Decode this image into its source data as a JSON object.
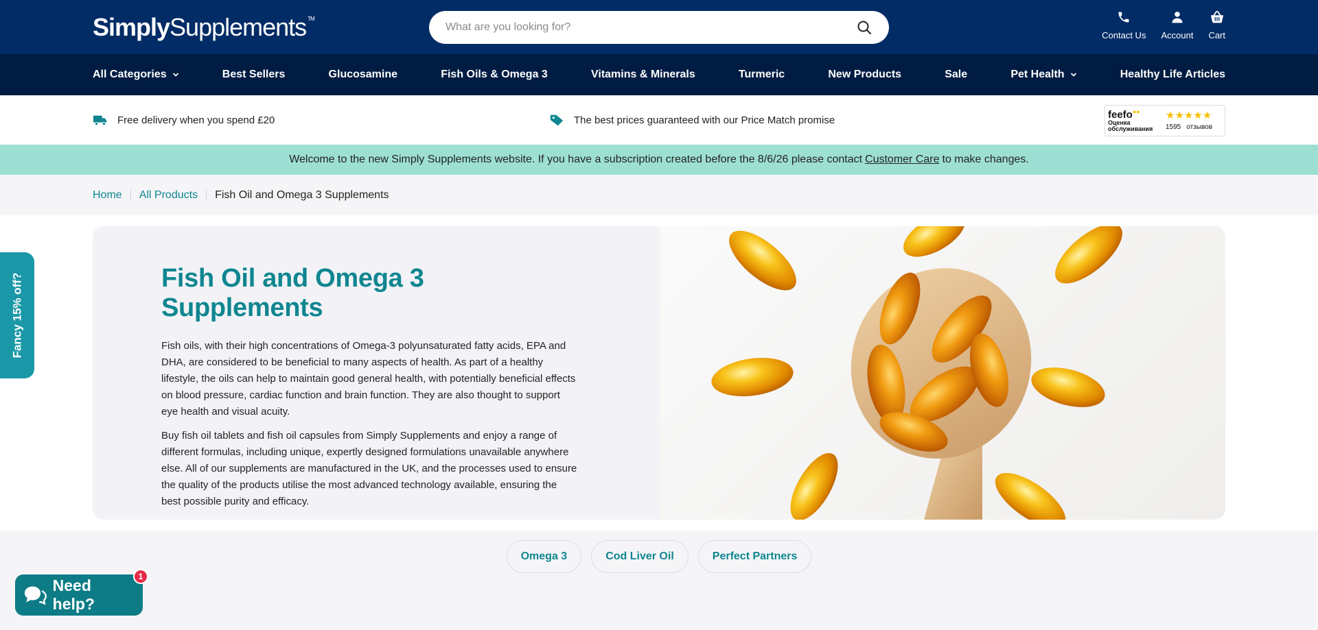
{
  "header": {
    "logo_bold": "Simply",
    "logo_rest": "Supplements",
    "logo_tm": "TM",
    "search_placeholder": "What are you looking for?",
    "links": {
      "contact": "Contact Us",
      "account": "Account",
      "cart": "Cart"
    }
  },
  "nav": {
    "items": [
      "All Categories",
      "Best Sellers",
      "Glucosamine",
      "Fish Oils & Omega 3",
      "Vitamins & Minerals",
      "Turmeric",
      "New Products",
      "Sale",
      "Pet Health",
      "Healthy Life Articles"
    ]
  },
  "usp": {
    "delivery": "Free delivery when you spend £20",
    "price": "The best prices guaranteed with our Price Match promise",
    "feefo": {
      "brand": "feefo",
      "sub": "Оценка обслуживания",
      "stars": "★★★★★",
      "count": "1595",
      "reviews": "отзывов"
    }
  },
  "notice": {
    "before": "Welcome to the new Simply Supplements website. If you have a subscription created before the 8/6/26 please contact",
    "link": "Customer Care",
    "after": "to make changes."
  },
  "breadcrumb": {
    "home": "Home",
    "all": "All Products",
    "current": "Fish Oil and Omega 3 Supplements"
  },
  "hero": {
    "title": "Fish Oil and Omega 3 Supplements",
    "p1": "Fish oils, with their high concentrations of Omega-3 polyunsaturated fatty acids, EPA and DHA, are considered to be beneficial to many aspects of health. As part of a healthy lifestyle, the oils can help to maintain good general health, with potentially beneficial effects on blood pressure, cardiac function and brain function. They are also thought to support eye health and visual acuity.",
    "p2": "Buy fish oil tablets and fish oil capsules from Simply Supplements and enjoy a range of different formulas, including unique, expertly designed formulations unavailable anywhere else. All of our supplements are manufactured in the UK, and the processes used to ensure the quality of the products utilise the most advanced technology available, ensuring the best possible purity and efficacy."
  },
  "chips": [
    "Omega 3",
    "Cod Liver Oil",
    "Perfect Partners"
  ],
  "side_tab": "Fancy 15% off?",
  "chat": {
    "label": "Need help?",
    "badge": "1"
  },
  "colors": {
    "header_bg": "#022c66",
    "nav_bg": "#001c42",
    "accent_teal": "#0f8690",
    "notice_bg": "#9de0d3"
  }
}
